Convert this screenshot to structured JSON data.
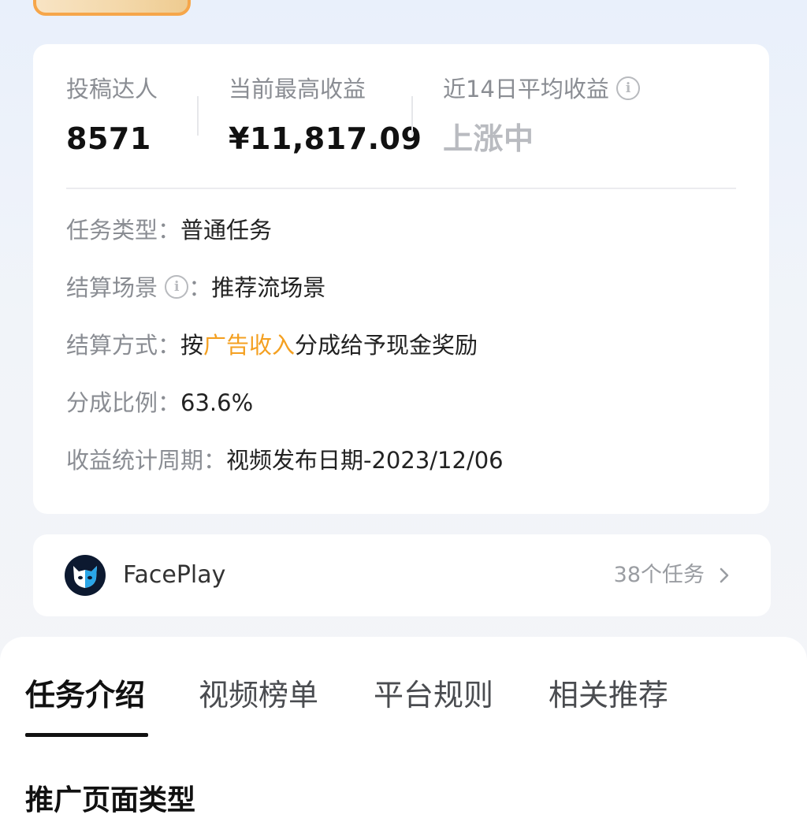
{
  "stats": {
    "creators_label": "投稿达人",
    "creators_value": "8571",
    "max_earning_label": "当前最高收益",
    "max_earning_value": "¥11,817.09",
    "avg14_label": "近14日平均收益",
    "avg14_value": "上涨中"
  },
  "details": {
    "task_type_key": "任务类型：",
    "task_type_value": "普通任务",
    "settle_scene_key": "结算场景",
    "settle_scene_colon": "：",
    "settle_scene_value": "推荐流场景",
    "settle_method_key": "结算方式：",
    "settle_method_pre": "按",
    "settle_method_accent": "广告收入",
    "settle_method_post": "分成给予现金奖励",
    "share_ratio_key": "分成比例：",
    "share_ratio_value": "63.6%",
    "stat_period_key": "收益统计周期：",
    "stat_period_value": "视频发布日期-2023/12/06",
    "info_glyph": "i"
  },
  "app": {
    "name": "FacePlay",
    "tasks": "38个任务"
  },
  "tabs": [
    {
      "label": "任务介绍"
    },
    {
      "label": "视频榜单"
    },
    {
      "label": "平台规则"
    },
    {
      "label": "相关推荐"
    }
  ],
  "section": {
    "title": "推广页面类型"
  },
  "colors": {
    "accent": "#f4a021",
    "logo_bg": "#0c1930",
    "logo_face": "#ffffff",
    "logo_eye": "#2aa6e8"
  }
}
